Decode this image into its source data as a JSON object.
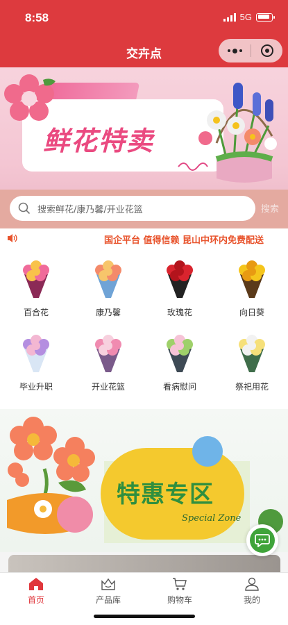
{
  "status": {
    "time": "8:58",
    "network": "5G"
  },
  "nav": {
    "title": "交卉点"
  },
  "banner": {
    "title": "鲜花特卖",
    "search_placeholder": "搜索鲜花/康乃馨/开业花篮",
    "search_button": "搜索"
  },
  "notice": {
    "text": "国企平台 值得信赖 昆山中环内免费配送"
  },
  "categories": [
    {
      "label": "百合花",
      "icon": "lily-bouquet",
      "colors": [
        "#f06b9a",
        "#f9c24b",
        "#8b2a56"
      ]
    },
    {
      "label": "康乃馨",
      "icon": "carnation-bouquet",
      "colors": [
        "#f48a6a",
        "#f7c56b",
        "#6fa3d6"
      ]
    },
    {
      "label": "玫瑰花",
      "icon": "rose-bouquet",
      "colors": [
        "#d9242e",
        "#b3141c",
        "#222222"
      ]
    },
    {
      "label": "向日葵",
      "icon": "sunflower-bouquet",
      "colors": [
        "#f5c51c",
        "#e89a12",
        "#5b3a1a"
      ]
    },
    {
      "label": "毕业升职",
      "icon": "graduation-bouquet",
      "colors": [
        "#b48ee0",
        "#f3b7d2",
        "#d9e6f5"
      ]
    },
    {
      "label": "开业花篮",
      "icon": "opening-basket",
      "colors": [
        "#f08bb0",
        "#f7d0de",
        "#7a5a8a"
      ]
    },
    {
      "label": "看病慰问",
      "icon": "get-well-bouquet",
      "colors": [
        "#9fd06a",
        "#f6c3d6",
        "#3e4a55"
      ]
    },
    {
      "label": "祭祀用花",
      "icon": "memorial-bouquet",
      "colors": [
        "#f6e07a",
        "#f2f2f2",
        "#3f6d4a"
      ]
    }
  ],
  "promo": {
    "title": "特惠专区",
    "subtitle": "Special Zone"
  },
  "tabs": [
    {
      "label": "首页",
      "icon": "home-icon",
      "active": true
    },
    {
      "label": "产品库",
      "icon": "crown-bag-icon",
      "active": false
    },
    {
      "label": "购物车",
      "icon": "cart-icon",
      "active": false
    },
    {
      "label": "我的",
      "icon": "user-icon",
      "active": false
    }
  ],
  "colors": {
    "brand_red": "#dd3a3e",
    "notice_orange": "#e8532c",
    "accent_green": "#2f8f3f"
  }
}
